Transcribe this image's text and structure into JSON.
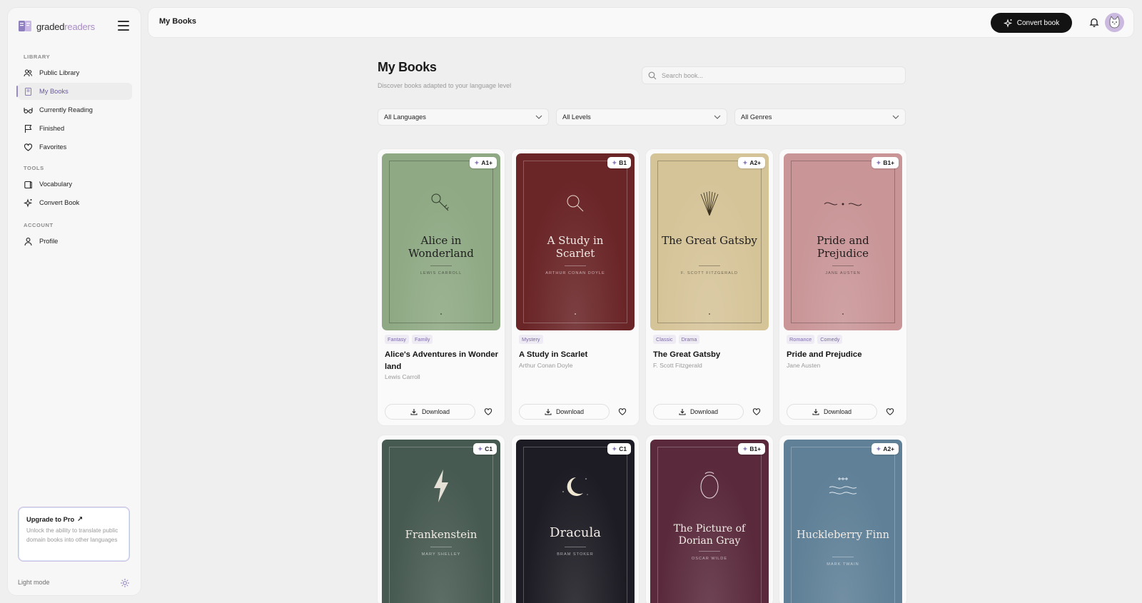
{
  "app": {
    "brand_a": "graded",
    "brand_b": "readers"
  },
  "topbar": {
    "title": "My Books",
    "convert_label": "Convert book"
  },
  "sidebar": {
    "sections": [
      "LIBRARY",
      "TOOLS",
      "ACCOUNT"
    ],
    "items": [
      {
        "label": "Public Library",
        "icon": "people-icon"
      },
      {
        "label": "My Books",
        "icon": "book-icon",
        "active": true
      },
      {
        "label": "Currently Reading",
        "icon": "glasses-icon"
      },
      {
        "label": "Finished",
        "icon": "flag-icon"
      },
      {
        "label": "Favorites",
        "icon": "heart-icon"
      },
      {
        "label": "Vocabulary",
        "icon": "vocabulary-icon"
      },
      {
        "label": "Convert Book",
        "icon": "sparkle-icon"
      },
      {
        "label": "Profile",
        "icon": "user-icon"
      }
    ],
    "upgrade": {
      "title": "Upgrade to Pro",
      "arrow": "↗",
      "desc": "Unlock the ability to translate public domain books into other languages"
    },
    "theme_label": "Light mode"
  },
  "main": {
    "title": "My Books",
    "subtitle": "Discover books adapted to your language level",
    "search_placeholder": "Search book...",
    "filters": [
      "All Languages",
      "All Levels",
      "All Genres"
    ],
    "download_label": "Download"
  },
  "books": [
    {
      "cover_title": "Alice in Wonderland",
      "cover_author": "LEWIS CARROLL",
      "level": "A1+",
      "tags": [
        "Fantasy",
        "Family"
      ],
      "title": "Alice's Adventures in Wonderland",
      "author": "Lewis Carroll",
      "color": "#8fa984",
      "art": "key"
    },
    {
      "cover_title": "A Study in Scarlet",
      "cover_author": "ARTHUR CONAN DOYLE",
      "level": "B1",
      "tags": [
        "Mystery"
      ],
      "title": "A Study in Scarlet",
      "author": "Arthur Conan Doyle",
      "color": "#6a2527",
      "art": "magnifier"
    },
    {
      "cover_title": "The Great Gatsby",
      "cover_author": "F. SCOTT FITZGERALD",
      "level": "A2+",
      "tags": [
        "Classic",
        "Drama"
      ],
      "title": "The Great Gatsby",
      "author": "F. Scott Fitzgerald",
      "color": "#d6c499",
      "art": "fan"
    },
    {
      "cover_title": "Pride and Prejudice",
      "cover_author": "JANE AUSTEN",
      "level": "B1+",
      "tags": [
        "Romance",
        "Comedy"
      ],
      "title": "Pride and Prejudice",
      "author": "Jane Austen",
      "color": "#c99597",
      "art": "flourish"
    },
    {
      "cover_title": "Frankenstein",
      "cover_author": "MARY SHELLEY",
      "level": "C1",
      "color": "#475a51",
      "art": "bolt"
    },
    {
      "cover_title": "Dracula",
      "cover_author": "BRAM STOKER",
      "level": "C1",
      "color": "#1d1c24",
      "art": "moon"
    },
    {
      "cover_title": "The Picture of Dorian Gray",
      "cover_author": "OSCAR WILDE",
      "level": "B1+",
      "color": "#5a2a3c",
      "art": "mirror"
    },
    {
      "cover_title": "Huckleberry Finn",
      "cover_author": "MARK TWAIN",
      "level": "A2+",
      "color": "#5f8097",
      "art": "waves"
    }
  ]
}
